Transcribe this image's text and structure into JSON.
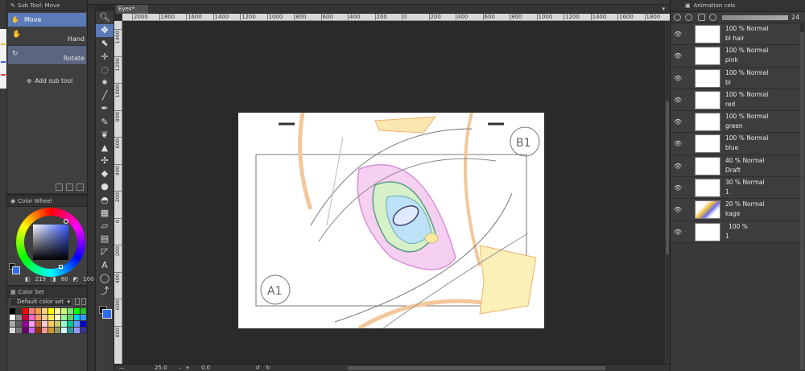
{
  "subtool": {
    "header": "Sub Tool: Move",
    "active_tool": "Move",
    "items": [
      {
        "label": "Hand",
        "icon": "hand-icon"
      },
      {
        "label": "Rotate",
        "icon": "rotate-icon"
      }
    ],
    "add_label": "Add sub tool"
  },
  "color_wheel": {
    "header": "Color Wheel",
    "h": "219",
    "s": "80",
    "v": "100",
    "main_color": "#2f6cf0",
    "sub_color": "#111111"
  },
  "color_set": {
    "header": "Color Set",
    "selected": "Default color set",
    "swatches": [
      "#000000",
      "#3a3a3a",
      "#ff0000",
      "#ff7f7f",
      "#ff9a3c",
      "#ffd080",
      "#ffff00",
      "#fff39a",
      "#c8ff7a",
      "#7ae07a",
      "#00ff00",
      "#2fbf2f",
      "#ffffff",
      "#8a8a8a",
      "#cc0033",
      "#ff66cc",
      "#ff9966",
      "#ffcc99",
      "#ffee66",
      "#ffffcc",
      "#99ff99",
      "#66cc66",
      "#00ccff",
      "#3399ff",
      "#aaaaaa",
      "#5c5c5c",
      "#990099",
      "#ff99ff",
      "#cc6633",
      "#ffcccc",
      "#ffcc66",
      "#cccc66",
      "#99ffcc",
      "#00cc99",
      "#6699ff",
      "#0000cc",
      "#dddddd",
      "#777777",
      "#660066",
      "#cc66ff",
      "#993300",
      "#ff9999",
      "#cc9933",
      "#999966",
      "#ccffff",
      "#339999",
      "#9999ff",
      "#333399"
    ]
  },
  "canvas": {
    "tab": "Eyes*",
    "ruler_top": [
      "2000",
      "1800",
      "1600",
      "1400",
      "1200",
      "1000",
      "800",
      "600",
      "400",
      "200",
      "0",
      "200",
      "400",
      "600",
      "800",
      "1000",
      "1200",
      "1400",
      "1600",
      "1800"
    ],
    "ruler_left": [
      "1400",
      "1200",
      "1000",
      "800",
      "600",
      "400",
      "200",
      "0",
      "200",
      "400",
      "600",
      "800"
    ],
    "zoom": "25.0",
    "angle": "0.0",
    "labels": {
      "a1": "A1",
      "b1": "B1"
    }
  },
  "animation": {
    "header": "Animation cels",
    "opacity": "24",
    "layers": [
      {
        "mode": "100 % Normal",
        "name": "bl hair"
      },
      {
        "mode": "100 % Normal",
        "name": "pink"
      },
      {
        "mode": "100 % Normal",
        "name": "bl"
      },
      {
        "mode": "100 % Normal",
        "name": "red"
      },
      {
        "mode": "100 % Normal",
        "name": "green"
      },
      {
        "mode": "100 % Normal",
        "name": "blue"
      },
      {
        "mode": "40 % Normal",
        "name": "Draft"
      },
      {
        "mode": "30 % Normal",
        "name": "1"
      },
      {
        "mode": "20 % Normal",
        "name": "kage"
      },
      {
        "mode": "100 %",
        "name": "1"
      }
    ]
  },
  "toolbar": {
    "tools": [
      "zoom-icon",
      "move-icon",
      "operation-icon",
      "move-layer-icon",
      "lasso-icon",
      "magic-wand-icon",
      "eyedropper-icon",
      "pen-icon",
      "pencil-icon",
      "brush-icon",
      "airbrush-icon",
      "decoration-icon",
      "eraser-icon",
      "blend-icon",
      "fill-icon",
      "gradient-icon",
      "figure-icon",
      "frame-icon",
      "ruler-icon",
      "text-icon",
      "balloon-icon",
      "correct-line-icon"
    ]
  }
}
